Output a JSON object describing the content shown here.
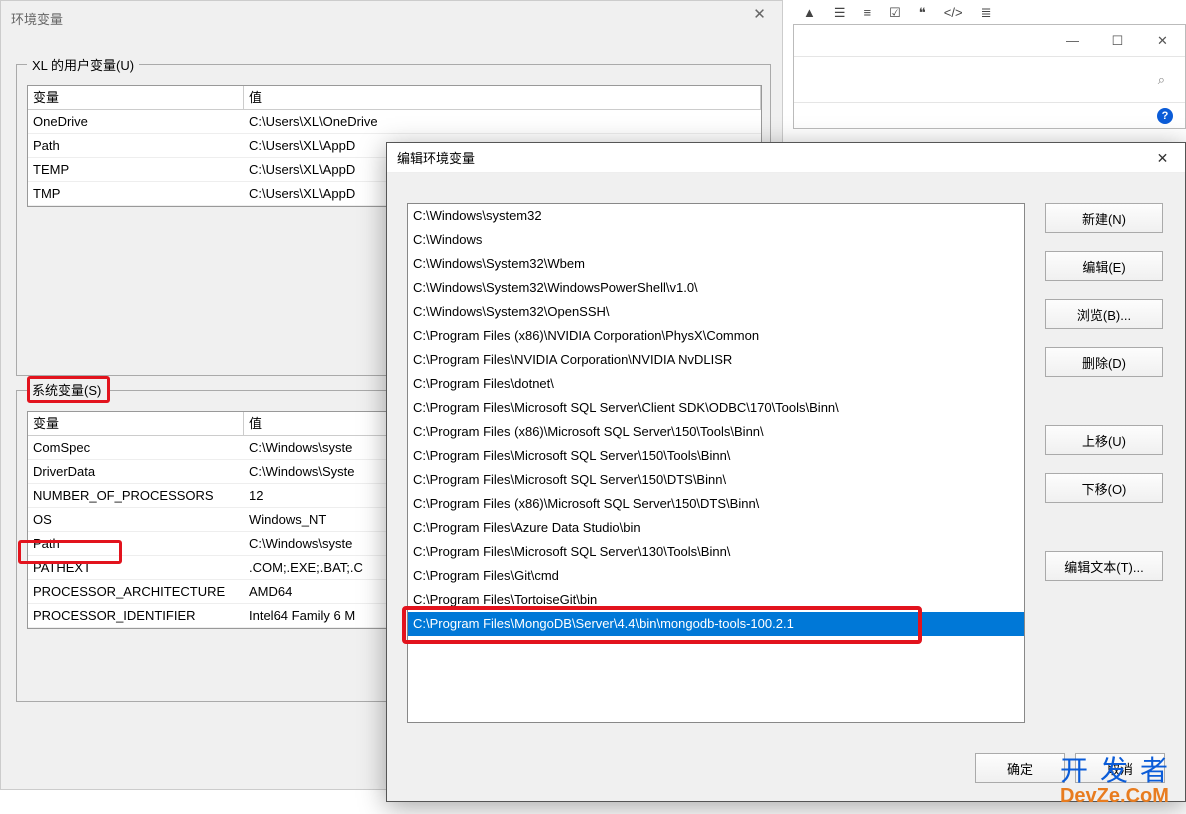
{
  "bg": {
    "title": "环境变量",
    "groupUser": "XL 的用户变量(U)",
    "groupSys": "系统变量(S)",
    "colVar": "变量",
    "colVal": "值",
    "userVars": [
      {
        "name": "OneDrive",
        "value": "C:\\Users\\XL\\OneDrive"
      },
      {
        "name": "Path",
        "value": "C:\\Users\\XL\\AppD"
      },
      {
        "name": "TEMP",
        "value": "C:\\Users\\XL\\AppD"
      },
      {
        "name": "TMP",
        "value": "C:\\Users\\XL\\AppD"
      }
    ],
    "sysVars": [
      {
        "name": "ComSpec",
        "value": "C:\\Windows\\syste"
      },
      {
        "name": "DriverData",
        "value": "C:\\Windows\\Syste"
      },
      {
        "name": "NUMBER_OF_PROCESSORS",
        "value": "12"
      },
      {
        "name": "OS",
        "value": "Windows_NT"
      },
      {
        "name": "Path",
        "value": "C:\\Windows\\syste"
      },
      {
        "name": "PATHEXT",
        "value": ".COM;.EXE;.BAT;.C"
      },
      {
        "name": "PROCESSOR_ARCHITECTURE",
        "value": "AMD64"
      },
      {
        "name": "PROCESSOR_IDENTIFIER",
        "value": "Intel64 Family 6 M"
      }
    ]
  },
  "fg": {
    "title": "编辑环境变量",
    "entries": [
      "C:\\Windows\\system32",
      "C:\\Windows",
      "C:\\Windows\\System32\\Wbem",
      "C:\\Windows\\System32\\WindowsPowerShell\\v1.0\\",
      "C:\\Windows\\System32\\OpenSSH\\",
      "C:\\Program Files (x86)\\NVIDIA Corporation\\PhysX\\Common",
      "C:\\Program Files\\NVIDIA Corporation\\NVIDIA NvDLISR",
      "C:\\Program Files\\dotnet\\",
      "C:\\Program Files\\Microsoft SQL Server\\Client SDK\\ODBC\\170\\Tools\\Binn\\",
      "C:\\Program Files (x86)\\Microsoft SQL Server\\150\\Tools\\Binn\\",
      "C:\\Program Files\\Microsoft SQL Server\\150\\Tools\\Binn\\",
      "C:\\Program Files\\Microsoft SQL Server\\150\\DTS\\Binn\\",
      "C:\\Program Files (x86)\\Microsoft SQL Server\\150\\DTS\\Binn\\",
      "C:\\Program Files\\Azure Data Studio\\bin",
      "C:\\Program Files\\Microsoft SQL Server\\130\\Tools\\Binn\\",
      "C:\\Program Files\\Git\\cmd",
      "C:\\Program Files\\TortoiseGit\\bin",
      "C:\\Program Files\\MongoDB\\Server\\4.4\\bin\\mongodb-tools-100.2.1"
    ],
    "selectedIndex": 17,
    "btnNew": "新建(N)",
    "btnEdit": "编辑(E)",
    "btnBrowse": "浏览(B)...",
    "btnDelete": "删除(D)",
    "btnUp": "上移(U)",
    "btnDown": "下移(O)",
    "btnEditText": "编辑文本(T)...",
    "btnOk": "确定",
    "btnCancel": "取消"
  },
  "watermark": {
    "line1": "开发者",
    "line2": "DevZe.CoM"
  }
}
